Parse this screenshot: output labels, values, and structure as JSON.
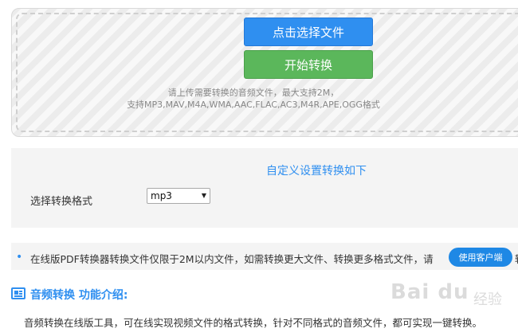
{
  "upload": {
    "select_button": "点击选择文件",
    "start_button": "开始转换",
    "hint_line1": "请上传需要转换的音频文件，最大支持2M，",
    "hint_line2": "支持MP3,MAV,M4A,WMA,AAC,FLAC,AC3,M4R,APE,OGG格式"
  },
  "settings": {
    "title": "自定义设置转换如下",
    "format_label": "选择转换格式",
    "format_value": "mp3"
  },
  "notice": {
    "bullet": "•",
    "text": "在线版PDF转换器转换文件仅限于2M以内文件，如需转换更大文件、转换更多格式文件，请",
    "client_button": "使用客户端",
    "tail": "转"
  },
  "intro": {
    "title": "音频转换 功能介绍:",
    "text": "音频转换在线版工具，可在线实现视频文件的格式转换，针对不同格式的音频文件，都可实现一键转换。"
  },
  "watermark": {
    "brand": "Bai du",
    "sub": "经验"
  },
  "colors": {
    "accent_blue": "#2f8ff0",
    "start_green": "#5bb75b"
  }
}
